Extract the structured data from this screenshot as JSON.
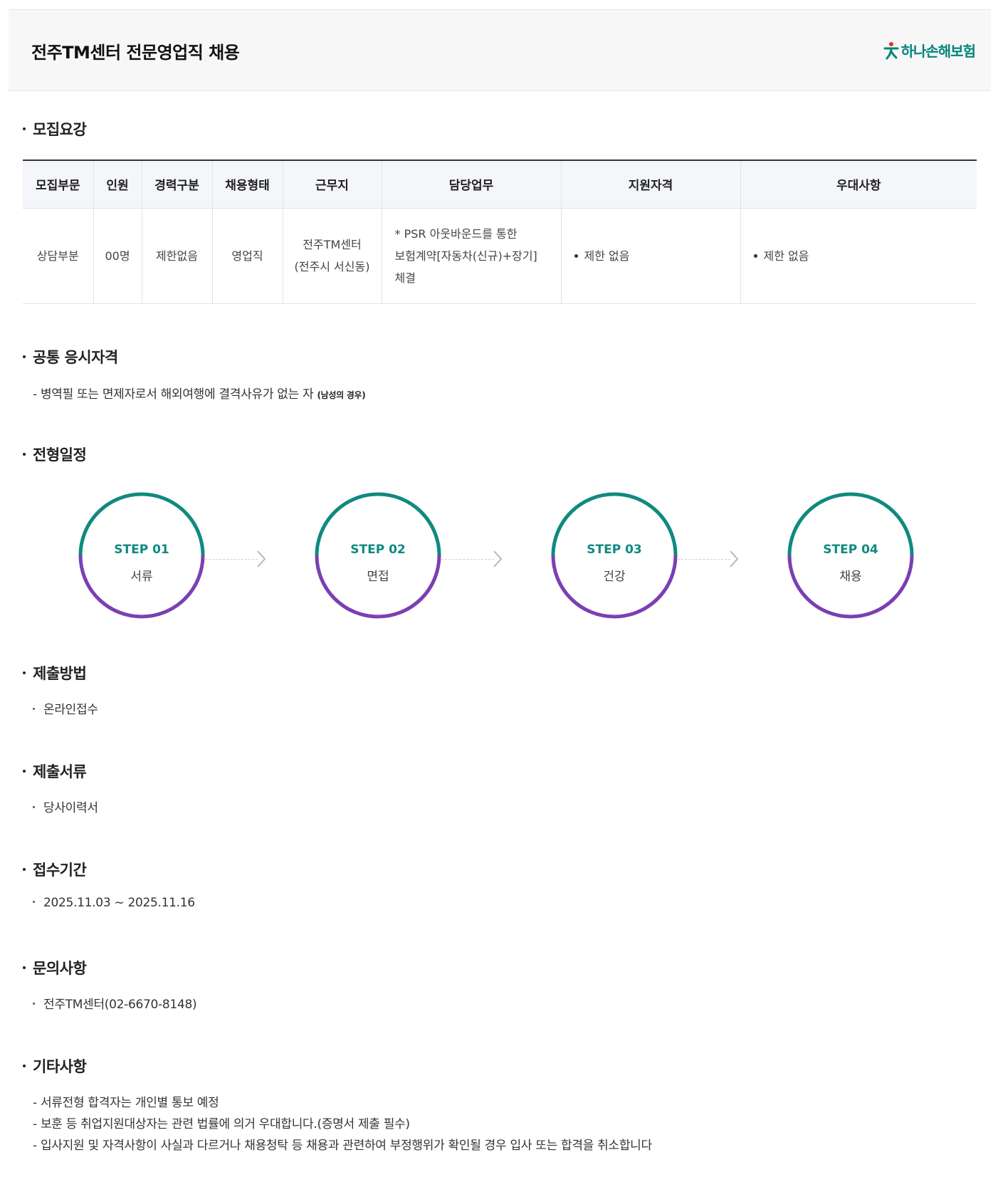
{
  "header": {
    "title": "전주TM센터 전문영업직 채용",
    "logo_text": "하나손해보험"
  },
  "sections": {
    "recruit": "모집요강",
    "common": "공통 응시자격",
    "schedule": "전형일정",
    "method": "제출방법",
    "documents": "제출서류",
    "period": "접수기간",
    "inquiry": "문의사항",
    "etc": "기타사항"
  },
  "table": {
    "headers": [
      "모집부문",
      "인원",
      "경력구분",
      "채용형태",
      "근무지",
      "담당업무",
      "지원자격",
      "우대사항"
    ],
    "row": {
      "department": "상담부분",
      "headcount": "00명",
      "career": "제한없음",
      "type": "영업직",
      "location_line1": "전주TM센터",
      "location_line2": "(전주시 서신동)",
      "duty_line1": "* PSR 아웃바운드를 통한",
      "duty_line2": "보험계약[자동차(신규)+장기]",
      "duty_line3": "체결",
      "qualification": "제한 없음",
      "preference": "제한 없음"
    }
  },
  "common": {
    "text": "- 병역필 또는 면제자로서 해외여행에 결격사유가 없는 자",
    "note": "(남성의 경우)"
  },
  "steps": [
    {
      "label": "STEP 01",
      "name": "서류"
    },
    {
      "label": "STEP 02",
      "name": "면접"
    },
    {
      "label": "STEP 03",
      "name": "건강"
    },
    {
      "label": "STEP 04",
      "name": "채용"
    }
  ],
  "method_text": "온라인접수",
  "documents_text": "당사이력서",
  "period_text": "2025.11.03 ~ 2025.11.16",
  "inquiry_text": "전주TM센터(02-6670-8148)",
  "etc_lines": [
    "- 서류전형 합격자는 개인별 통보 예정",
    "- 보훈 등 취업지원대상자는 관련 법률에 의거 우대합니다.(증명서 제출 필수)",
    "- 입사지원 및 자격사항이 사실과 다르거나 채용청탁 등 채용과 관련하여 부정행위가 확인될 경우 입사 또는 합격을 취소합니다"
  ],
  "colors": {
    "teal": "#0f8a80",
    "purple": "#7b3fb3",
    "logo_green": "#00857a",
    "logo_red": "#e4312b"
  }
}
